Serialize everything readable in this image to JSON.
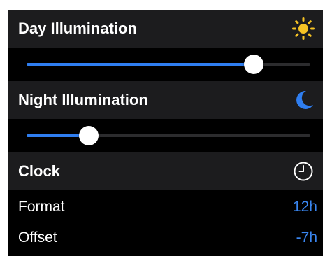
{
  "day": {
    "title": "Day Illumination",
    "icon": "sun-icon",
    "icon_color": "#f6c324",
    "slider_value": 0.8
  },
  "night": {
    "title": "Night Illumination",
    "icon": "moon-icon",
    "icon_color": "#2f7ef0",
    "slider_value": 0.22
  },
  "clock": {
    "title": "Clock",
    "icon": "clock-icon",
    "rows": [
      {
        "label": "Format",
        "value": "12h"
      },
      {
        "label": "Offset",
        "value": "-7h"
      }
    ]
  },
  "colors": {
    "accent": "#2f7ef0",
    "header_bg": "#1c1c1e",
    "background": "#000000",
    "value_text": "#3a86f0"
  }
}
